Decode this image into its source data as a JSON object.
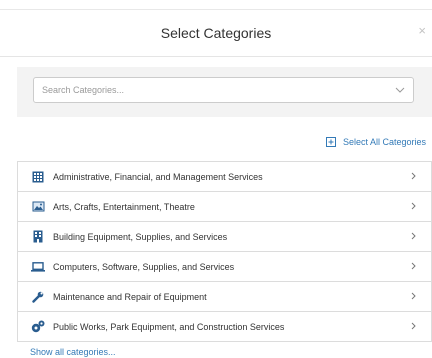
{
  "modal": {
    "title": "Select Categories",
    "close_glyph": "×"
  },
  "search": {
    "placeholder": "Search Categories...",
    "value": ""
  },
  "select_all": {
    "label": "Select All Categories",
    "icon": "plus-square-icon"
  },
  "categories": [
    {
      "label": "Administrative, Financial, and Management Services",
      "icon": "building-grid-icon"
    },
    {
      "label": "Arts, Crafts, Entertainment, Theatre",
      "icon": "picture-icon"
    },
    {
      "label": "Building Equipment, Supplies, and Services",
      "icon": "office-building-icon"
    },
    {
      "label": "Computers, Software, Supplies, and Services",
      "icon": "laptop-icon"
    },
    {
      "label": "Maintenance and Repair of Equipment",
      "icon": "wrench-icon"
    },
    {
      "label": "Public Works, Park Equipment, and Construction Services",
      "icon": "cogs-icon"
    }
  ],
  "show_all": {
    "label": "Show all categories..."
  },
  "colors": {
    "link": "#337ab7",
    "icon": "#2a5d8f",
    "panel_bg": "#f3f3f3",
    "border": "#dcdcdc"
  }
}
